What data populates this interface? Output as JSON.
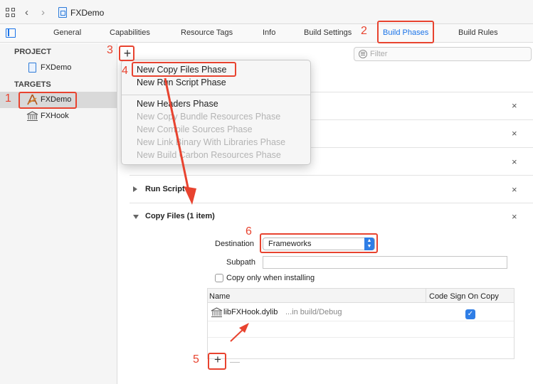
{
  "toolbar": {
    "breadcrumb": "FXDemo",
    "back_icon": "chevron-left-icon",
    "forward_icon": "chevron-right-icon"
  },
  "tabs": [
    {
      "label": "General"
    },
    {
      "label": "Capabilities"
    },
    {
      "label": "Resource Tags"
    },
    {
      "label": "Info"
    },
    {
      "label": "Build Settings"
    },
    {
      "label": "Build Phases",
      "active": true
    },
    {
      "label": "Build Rules"
    }
  ],
  "sidebar": {
    "project_header": "PROJECT",
    "project_item": "FXDemo",
    "targets_header": "TARGETS",
    "targets": [
      {
        "label": "FXDemo",
        "selected": true
      },
      {
        "label": "FXHook"
      }
    ]
  },
  "filter": {
    "placeholder": "Filter"
  },
  "add_phase_label": "+",
  "menu": {
    "items": [
      {
        "label": "New Copy Files Phase",
        "enabled": true
      },
      {
        "label": "New Run Script Phase",
        "enabled": true
      },
      {
        "label": "New Headers Phase",
        "enabled": true
      },
      {
        "label": "New Copy Bundle Resources Phase",
        "enabled": false
      },
      {
        "label": "New Compile Sources Phase",
        "enabled": false
      },
      {
        "label": "New Link Binary With Libraries Phase",
        "enabled": false
      },
      {
        "label": "New Build Carbon Resources Phase",
        "enabled": false
      }
    ]
  },
  "phases": {
    "run_script": "Run Script",
    "copy_files": "Copy Files (1 item)",
    "close_label": "×"
  },
  "copy_files": {
    "destination_label": "Destination",
    "destination_value": "Frameworks",
    "subpath_label": "Subpath",
    "subpath_value": "",
    "copy_only_label": "Copy only when installing",
    "table": {
      "col_name": "Name",
      "col_codesign": "Code Sign On Copy",
      "rows": [
        {
          "name": "libFXHook.dylib",
          "location": "...in build/Debug",
          "code_sign": true
        }
      ]
    },
    "add_label": "+",
    "remove_label": "—"
  },
  "annotations": {
    "n1": "1",
    "n2": "2",
    "n3": "3",
    "n4": "4",
    "n5": "5",
    "n6": "6",
    "accent": "#e8432f"
  }
}
